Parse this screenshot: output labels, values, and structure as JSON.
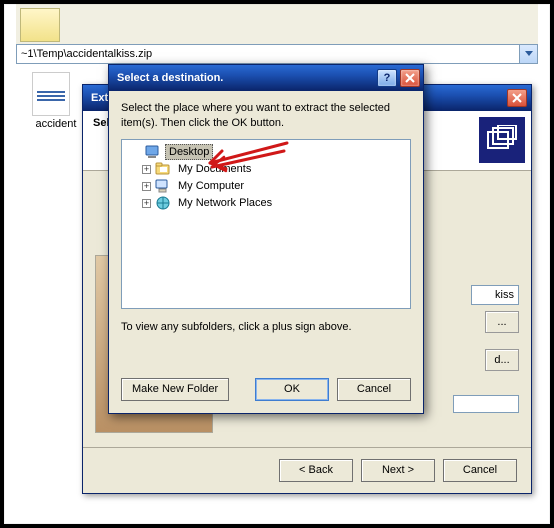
{
  "path_bar": {
    "text": "~1\\Temp\\accidentalkiss.zip"
  },
  "icon": {
    "label": "accident"
  },
  "extract_wizard": {
    "title": "Extrac",
    "header_line1": "Sel",
    "path_visible": "kiss",
    "browse_label": "...",
    "pwd_label": "d...",
    "back_label": "< Back",
    "next_label": "Next >",
    "cancel_label": "Cancel"
  },
  "dest_dialog": {
    "title": "Select a destination.",
    "instruction": "Select the place where you want to extract the selected item(s).  Then click the OK button.",
    "tree": {
      "desktop": "Desktop",
      "mydocs": "My Documents",
      "mycomp": "My Computer",
      "mynet": "My Network Places"
    },
    "hint": "To view any subfolders, click a plus sign above.",
    "make_folder_label": "Make New Folder",
    "ok_label": "OK",
    "cancel_label": "Cancel"
  }
}
